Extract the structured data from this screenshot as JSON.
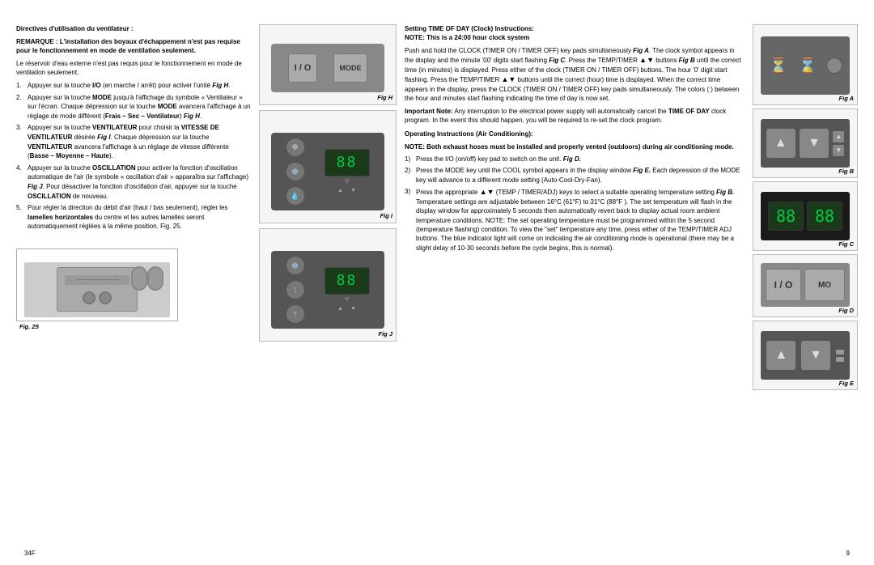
{
  "page": {
    "left_page_number": "34F",
    "right_page_number": "9"
  },
  "left_column": {
    "heading": "Directives d'utilisation du ventilateur :",
    "para1_bold": "REMARQUE : L'installation des boyaux d'échappement n'est pas requise pour le fonctionnement en mode de ventilation seulement.",
    "para2": "Le réservoir d'eau externe n'est pas requis pour le fonctionnement en mode de ventilation seulement.",
    "items": [
      "Appuyer sur la touche I/O (en marche / arrêt) pour activer l'unité Fig H.",
      "Appuyer sur la touche MODE jusqu'à l'affichage du symbole « Ventilateur » sur l'écran.  Chaque dépression sur la touche MODE avancera l'affichage à un réglage de mode différent (Frais – Sec – Ventilateur) Fig H.",
      "Appuyer sur la touche VENTILATEUR pour choisir la VITESSE DE VENTILATEUR désirée Fig I. Chaque dépression sur la touche VENTILATEUR avancera l'affichage à un réglage de vitesse différente (Basse – Moyenne – Haute).",
      "Appuyer sur la touche OSCILLATION pour activer la fonction d'oscillation automatique de l'air (le symbole « oscillation d'air » apparaîtra sur l'affichage) Fig J. Pour désactiver la fonction d'oscillation d'air, appuyer sur la touche OSCILLATION de nouveau.",
      "Pour régler la direction du débit d'air (haut / bas seulement), régler les lamelles horizontales du centre et les autres lamelles seront automatiquement réglées à la même position. Fig. 25."
    ],
    "fig25_label": "Fig. 25"
  },
  "middle_figs": {
    "fig_h_label": "Fig H",
    "fig_i_label": "Fig I",
    "fig_j_label": "Fig J",
    "panel_h": {
      "io_text": "I / O",
      "mode_text": "MODE"
    }
  },
  "right_column": {
    "section1": {
      "heading": "Setting TIME OF DAY (Clock) Instructions:",
      "subheading": "NOTE: This is a 24:00 hour clock system",
      "body": "Push and hold the CLOCK (TIMER ON / TIMER OFF) key pads simultaneously Fig A. The clock symbol appears in the display and the minute '00' digits  start flashing Fig C.  Press the TEMP/TIMER  buttons Fig B until the correct time (in minutes) is displayed. Press either of the clock (TIMER ON / TIMER OFF) buttons. The hour '0' digit start flashing. Press the TEMP/TIMER  buttons until the correct (hour) time is displayed. When the correct time appears in the display, press the CLOCK (TIMER ON / TIMER OFF) key pads simultaneously. The colors (:) between the hour and minutes start flashing indicating the time of day is now set.",
      "important_heading": "Important Note:",
      "important_body": "Any interruption to the electrical power supply will automatically cancel the TIME OF DAY clock program.  In the event this should happen, you will be required to re-set the clock program."
    },
    "section2": {
      "heading": "Operating Instructions (Air Conditioning):",
      "subheading": "NOTE: Both exhaust hoses must be installed and properly vented (outdoors) during air conditioning mode.",
      "items": [
        "Press the I/O (on/off) key pad to switch on the unit. Fig D.",
        "Press the MODE key until the COOL symbol appears  in the display window Fig E.  Each depression of the MODE key will advance to a different mode setting (Auto-Cool-Dry-Fan).",
        "Press the appropriate (TEMP / TIMER/ADJ) keys to select a suitable operating temperature setting Fig B.  Temperature settings are adjustable between 16°C (61°F) to 31°C (88°F ). The set temperature will flash in the display window for approximately 5 seconds then automatically revert back to display actual room ambient temperature conditions. NOTE: The set operating temperature must be programmed within the 5 second (temperature flashing) condition. To view the \"set\" temperature any time, press either of the TEMP/TIMER ADJ buttons. The blue indicator light will come on indicating the air conditioning mode is operational (there may be a slight delay of 10-30 seconds before the cycle begins, this is normal)."
      ]
    }
  },
  "right_figs": {
    "fig_a_label": "Fig A",
    "fig_b_label": "Fig B",
    "fig_c_label": "Fig C",
    "fig_d_label": "Fig D",
    "fig_e_label": "Fig E"
  },
  "icons": {
    "hourglass": "⏳",
    "arrow_up": "▲",
    "arrow_down": "▼",
    "snowflake": "❄",
    "fan": "❉",
    "oscillate": "↕",
    "io": "I/O",
    "mode": "MO"
  }
}
